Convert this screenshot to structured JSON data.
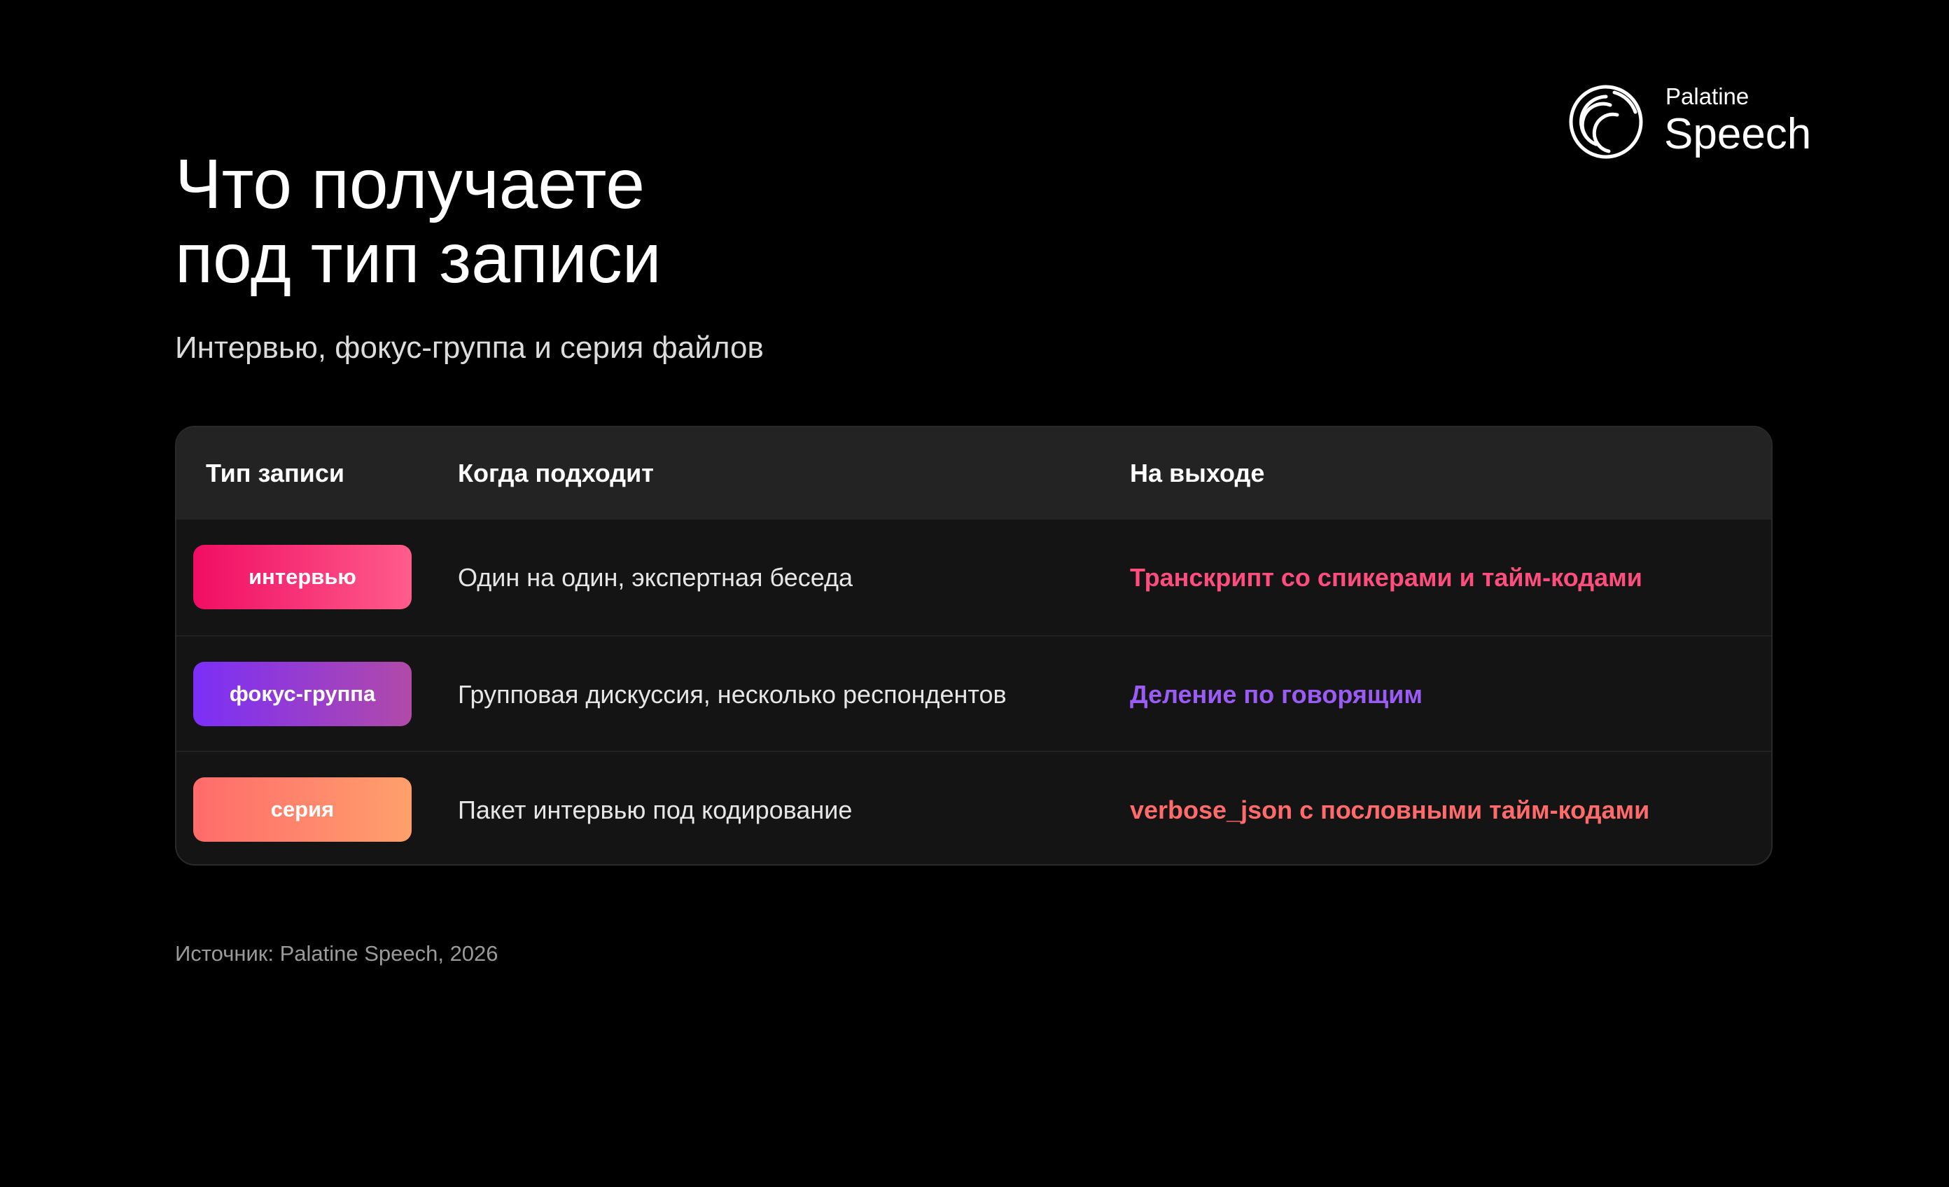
{
  "brand": {
    "name_small": "Palatine",
    "name_big": "Speech",
    "logo_icon": "concentric-arcs-logo-icon"
  },
  "slide": {
    "title_line1": "Что получаете",
    "title_line2": "под тип записи",
    "subtitle": "Интервью, фокус-группа и серия файлов",
    "source": "Источник: Palatine Speech, 2026"
  },
  "table": {
    "headers": [
      "Тип записи",
      "Когда подходит",
      "На выходе"
    ],
    "rows": [
      {
        "type": "интервью",
        "when": "Один на один, экспертная беседа",
        "output": "Транскрипт со спикерами и тайм-кодами",
        "output_color": "#ff4d7d"
      },
      {
        "type": "фокус-группа",
        "when": "Групповая дискуссия, несколько респондентов",
        "output": "Деление по говорящим",
        "output_color": "#9b5cf6"
      },
      {
        "type": "серия",
        "when": "Пакет интервью под кодирование",
        "output": "verbose_json с пословными тайм-кодами",
        "output_color": "#ff6b6b"
      }
    ]
  },
  "colors": {
    "background": "#000000",
    "table_bg": "#141414",
    "header_bg": "#232323"
  }
}
